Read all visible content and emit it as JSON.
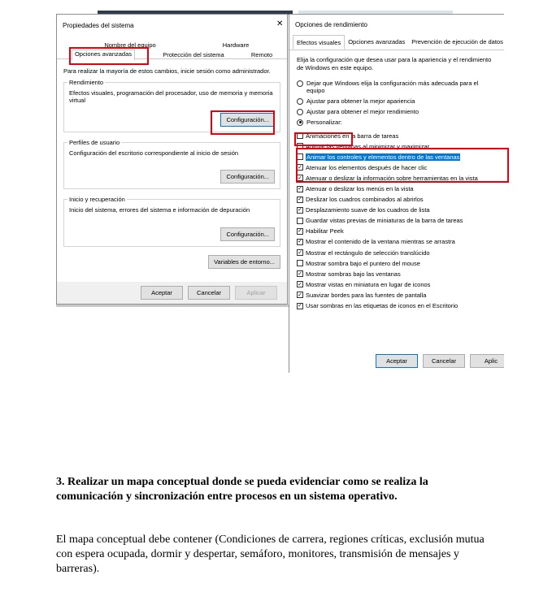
{
  "window1": {
    "title": "Propiedades del sistema",
    "close_glyph": "✕",
    "tabs_row1": [
      "Nombre del equipo",
      "Hardware"
    ],
    "tabs_row2": [
      "Opciones avanzadas",
      "Protección del sistema",
      "Remoto"
    ],
    "intro": "Para realizar la mayoría de estos cambios, inicie sesión como administrador.",
    "groups": [
      {
        "title": "Rendimiento",
        "text": "Efectos visuales, programación del procesador, uso de memoria y memoria virtual",
        "button": "Configuración..."
      },
      {
        "title": "Perfiles de usuario",
        "text": "Configuración del escritorio correspondiente al inicio de sesión",
        "button": "Configuración..."
      },
      {
        "title": "Inicio y recuperación",
        "text": "Inicio del sistema, errores del sistema e información de depuración",
        "button": "Configuración..."
      }
    ],
    "env_button": "Variables de entorno...",
    "buttons": {
      "accept": "Aceptar",
      "cancel": "Cancelar",
      "apply": "Aplicar"
    }
  },
  "window2": {
    "title": "Opciones de rendimiento",
    "tabs": [
      "Efectos visuales",
      "Opciones avanzadas",
      "Prevención de ejecución de datos"
    ],
    "intro": "Elija la configuración que desea usar para la apariencia y el rendimiento de Windows en este equipo.",
    "radios": [
      {
        "label": "Dejar que Windows elija la configuración más adecuada para el equipo",
        "selected": false
      },
      {
        "label": "Ajustar para obtener la mejor apariencia",
        "selected": false
      },
      {
        "label": "Ajustar para obtener el mejor rendimiento",
        "selected": false
      },
      {
        "label": "Personalizar:",
        "selected": true
      }
    ],
    "checks": [
      {
        "label": "Animaciones en la barra de tareas",
        "checked": false
      },
      {
        "label": "Animar las ventanas al minimizar y maximizar",
        "checked": false
      },
      {
        "label": "Animar los controles y elementos dentro de las ventanas",
        "checked": false
      },
      {
        "label": "Atenuar los elementos después de hacer clic",
        "checked": true
      },
      {
        "label": "Atenuar o deslizar la información sobre herramientas en la vista",
        "checked": true
      },
      {
        "label": "Atenuar o deslizar los menús en la vista",
        "checked": true
      },
      {
        "label": "Deslizar los cuadros combinados al abrirlos",
        "checked": true
      },
      {
        "label": "Desplazamiento suave de los cuadros de lista",
        "checked": true
      },
      {
        "label": "Guardar vistas previas de miniaturas de la barra de tareas",
        "checked": false
      },
      {
        "label": "Habilitar Peek",
        "checked": true
      },
      {
        "label": "Mostrar el contenido de la ventana mientras se arrastra",
        "checked": true
      },
      {
        "label": "Mostrar el rectángulo de selección translúcido",
        "checked": true
      },
      {
        "label": "Mostrar sombra bajo el puntero del mouse",
        "checked": false
      },
      {
        "label": "Mostrar sombras bajo las ventanas",
        "checked": true
      },
      {
        "label": "Mostrar vistas en miniatura en lugar de iconos",
        "checked": true
      },
      {
        "label": "Suavizar bordes para las fuentes de pantalla",
        "checked": true
      },
      {
        "label": "Usar sombras en las etiquetas de iconos en el Escritorio",
        "checked": true
      }
    ],
    "check_glyph": "✓",
    "buttons": {
      "accept": "Aceptar",
      "cancel": "Cancelar",
      "apply": "Aplic"
    }
  },
  "document": {
    "heading": "3. Realizar un mapa conceptual donde se pueda evidenciar como se realiza la comunicación y sincronización entre procesos en un sistema operativo.",
    "paragraph": "El mapa conceptual debe contener (Condiciones de carrera, regiones críticas, exclusión mutua con espera ocupada, dormir y despertar, semáforo, monitores, transmisión de mensajes y barreras)."
  }
}
